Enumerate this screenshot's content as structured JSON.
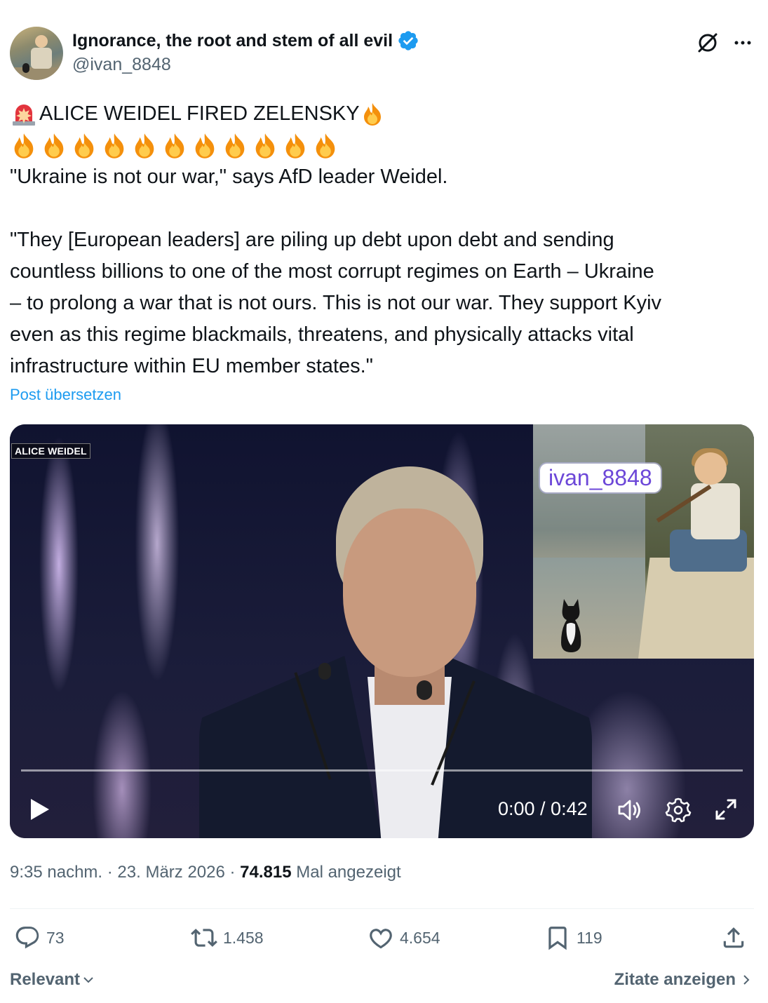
{
  "author": {
    "display_name": "Ignorance, the root and stem of all evil",
    "handle": "@ivan_8848"
  },
  "icons": {
    "verified": "verified-badge-icon",
    "grok": "grok-icon",
    "more": "more-options-icon"
  },
  "post": {
    "headline": "ALICE WEIDEL FIRED ZELENSKY",
    "lines": [
      "\"Ukraine is not our war,\" says AfD leader Weidel.",
      "\"They [European leaders] are piling up debt upon debt and sending",
      "countless billions to one of the most corrupt regimes on Earth – Ukraine",
      "– to prolong a war that is not ours. This is not our war. They support Kyiv",
      "even as this regime blackmails, threatens, and physically attacks vital",
      "infrastructure within EU member states.\""
    ],
    "translate_link": "Post übersetzen"
  },
  "video": {
    "overlay_label": "ALICE WEIDEL",
    "watermark": "ivan_8848",
    "time": "0:00 / 0:42",
    "progress": 0
  },
  "meta": {
    "time": "9:35 nachm.",
    "sep1": " · ",
    "date": "23. März 2026",
    "sep2": " · ",
    "views_count": "74.815",
    "views_label": " Mal angezeigt"
  },
  "actions": {
    "replies": "73",
    "reposts": "1.458",
    "likes": "4.654",
    "bookmarks": "119"
  },
  "footer": {
    "sort_label": "Relevant",
    "quotes_link": "Zitate anzeigen"
  },
  "colors": {
    "link": "#1d9bf0",
    "muted": "#536471",
    "text": "#0f1419",
    "verified": "#1d9bf0"
  }
}
